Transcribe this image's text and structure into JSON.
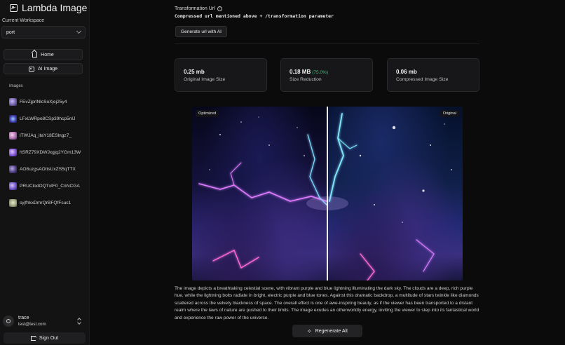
{
  "app": {
    "title": "Lambda Image"
  },
  "sidebar": {
    "workspace_label": "Current Workspace",
    "workspace_value": "port",
    "nav": [
      {
        "label": "Home",
        "icon": "home-icon"
      },
      {
        "label": "AI Image",
        "icon": "image-icon"
      }
    ],
    "images_label": "Images",
    "images": [
      {
        "name": "FEvZjprlNlcSoXjej25y4",
        "thumb": "#6b5a9e"
      },
      {
        "name": "LFxLWRpo8CSp39hcp5nIJ",
        "thumb": "#3d3aa8"
      },
      {
        "name": "ITWJAq_itaY18ESlngz7_",
        "thumb": "#a46aa8"
      },
      {
        "name": "hSRZ79XDWJxgjq2YGm13W",
        "thumb": "#7b4fd0"
      },
      {
        "name": "AO8uzgsAOttsUxZS5qTTX",
        "thumb": "#4b3a7a"
      },
      {
        "name": "PRUClodOQTxtF0_CnNCGA",
        "thumb": "#6a4fc4"
      },
      {
        "name": "syjfhkxDmrQrBFQfFsuc1",
        "thumb": "#9aa07a"
      }
    ],
    "user": {
      "name": "trace",
      "email": "test@test.com"
    },
    "signout_label": "Sign Out"
  },
  "main": {
    "transformation_label": "Transformation Url",
    "transformation_text": "Compressed url mentioned above + /transformation parameter",
    "generate_button": "Generate url with AI",
    "stats": [
      {
        "value": "0.25 mb",
        "label": "Original Image Size"
      },
      {
        "value": "0.18 MB",
        "pct": "(75.0%)",
        "label": "Size Reduction"
      },
      {
        "value": "0.06 mb",
        "label": "Compressed Image Size"
      }
    ],
    "compare": {
      "left_label": "Optimized",
      "right_label": "Original",
      "slider_position": 0.5
    },
    "description": "The image depicts a breathtaking celestial scene, with vibrant purple and blue lightning illuminating the dark sky. The clouds are a deep, rich purple hue, while the lightning bolts radiate in bright, electric purple and blue tones. Against this dramatic backdrop, a multitude of stars twinkle like diamonds scattered across the velvety blackness of space. The overall effect is one of awe-inspiring beauty, as if the viewer has been transported to a distant realm where the laws of nature are pushed to their limits. The image exudes an otherworldly energy, inviting the viewer to step into its fantastical world and experience the raw power of the universe.",
    "regenerate_button": "Regenerate Alt"
  }
}
